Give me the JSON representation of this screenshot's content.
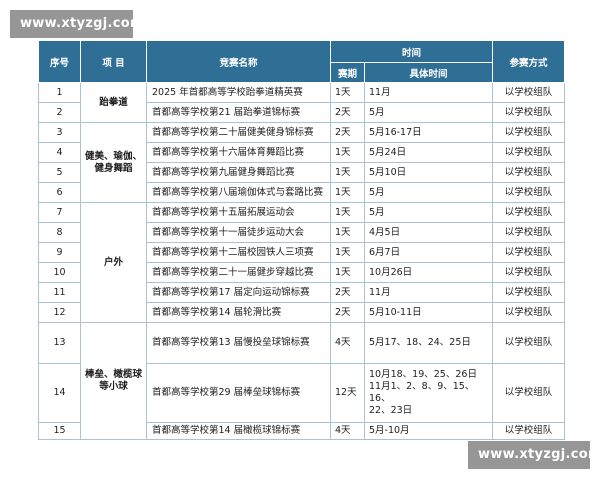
{
  "watermark": {
    "text": "www.xtyzgj.com"
  },
  "table": {
    "headers": {
      "index": "序号",
      "category": "项 目",
      "name": "竞赛名称",
      "time": "时间",
      "duration": "赛期",
      "dates": "具体时间",
      "mode": "参赛方式"
    },
    "categories": {
      "taekwondo": "跆拳道",
      "fitness": "健美、瑜伽、健身舞蹈",
      "outdoor": "户外",
      "ball": "棒垒、橄榄球等小球"
    },
    "rows": [
      {
        "no": "1",
        "name": "2025 年首都高等学校跆拳道精英赛",
        "duration": "1天",
        "dates": "11月",
        "mode": "以学校组队"
      },
      {
        "no": "2",
        "name": "首都高等学校第21 届跆拳道锦标赛",
        "duration": "2天",
        "dates": "5月",
        "mode": "以学校组队"
      },
      {
        "no": "3",
        "name": "首都高等学校第二十届健美健身锦标赛",
        "duration": "2天",
        "dates": "5月16-17日",
        "mode": "以学校组队"
      },
      {
        "no": "4",
        "name": "首都高等学校第十六届体育舞蹈比赛",
        "duration": "1天",
        "dates": "5月24日",
        "mode": "以学校组队"
      },
      {
        "no": "5",
        "name": "首都高等学校第九届健身舞蹈比赛",
        "duration": "1天",
        "dates": "5月10日",
        "mode": "以学校组队"
      },
      {
        "no": "6",
        "name": "首都高等学校第八届瑜伽体式与套路比赛",
        "duration": "1天",
        "dates": "5月",
        "mode": "以学校组队"
      },
      {
        "no": "7",
        "name": "首都高等学校第十五届拓展运动会",
        "duration": "1天",
        "dates": "5月",
        "mode": "以学校组队"
      },
      {
        "no": "8",
        "name": "首都高等学校第十一届徒步运动大会",
        "duration": "1天",
        "dates": "4月5日",
        "mode": "以学校组队"
      },
      {
        "no": "9",
        "name": "首都高等学校第十二届校园铁人三项赛",
        "duration": "1天",
        "dates": "6月7日",
        "mode": "以学校组队"
      },
      {
        "no": "10",
        "name": "首都高等学校第二十一届健步穿越比赛",
        "duration": "1天",
        "dates": "10月26日",
        "mode": "以学校组队"
      },
      {
        "no": "11",
        "name": "首都高等学校第17 届定向运动锦标赛",
        "duration": "2天",
        "dates": "11月",
        "mode": "以学校组队"
      },
      {
        "no": "12",
        "name": "首都高等学校第14 届轮滑比赛",
        "duration": "2天",
        "dates": "5月10-11日",
        "mode": "以学校组队"
      },
      {
        "no": "13",
        "name": "首都高等学校第13 届慢投垒球锦标赛",
        "duration": "4天",
        "dates": "5月17、18、24、25日",
        "mode": "以学校组队"
      },
      {
        "no": "14",
        "name": "首都高等学校第29 届棒垒球锦标赛",
        "duration": "12天",
        "dates": "10月18、19、25、26日\n11月1、2、8、9、15、16、\n22、23日",
        "mode": "以学校组队"
      },
      {
        "no": "15",
        "name": "首都高等学校第14 届橄榄球锦标赛",
        "duration": "4天",
        "dates": "5月-10月",
        "mode": "以学校组队"
      }
    ]
  }
}
